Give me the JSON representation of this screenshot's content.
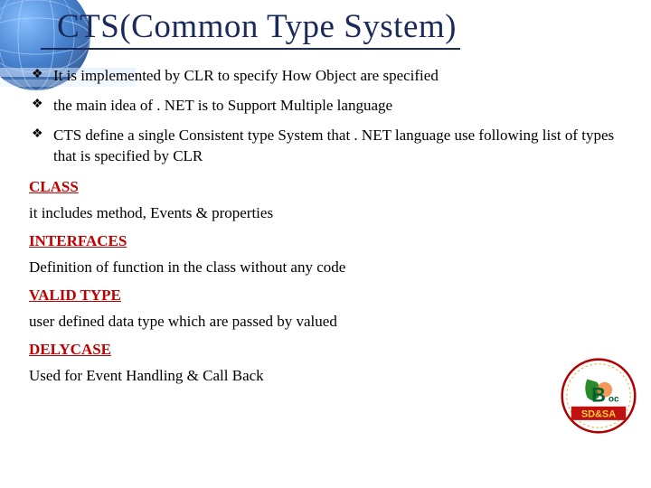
{
  "title": "CTS(Common Type System)",
  "bullets": [
    "It is implemented  by CLR to specify How Object are specified",
    " the main idea of . NET is to Support Multiple language",
    "CTS define a single Consistent type System that  . NET language use following list of types that is specified by CLR"
  ],
  "sections": [
    {
      "head": "CLASS",
      "body": " it includes method, Events & properties"
    },
    {
      "head": "INTERFACES",
      "body": "Definition of function  in the class without any code"
    },
    {
      "head": "VALID TYPE",
      "body": "user defined data type which are passed by valued"
    },
    {
      "head": "DELYCASE",
      "body": "Used for Event Handling & Call Back"
    }
  ],
  "logo": {
    "top_text": "B",
    "sub_text": "oc",
    "bottom_text": "SD&SA"
  }
}
